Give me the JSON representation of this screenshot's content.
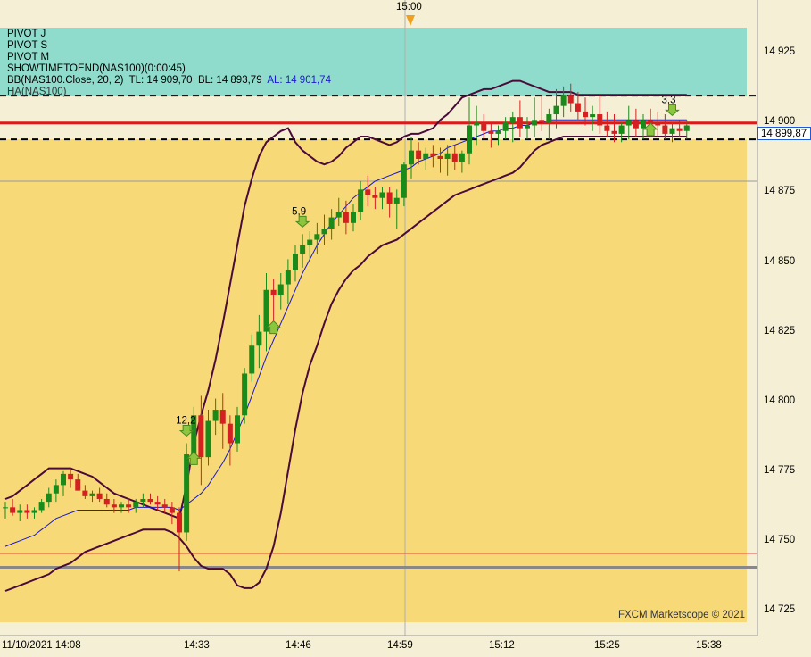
{
  "legend": {
    "line1": "PIVOT J",
    "line2": "PIVOT S",
    "line3": "PIVOT M",
    "line4": "SHOWTIMETOEND(NAS100)(0:00:45)",
    "bb_prefix": "BB(NAS100.Close, 20, 2)",
    "bb_tl": "TL: 14 909,70",
    "bb_bl": "BL: 14 893,79",
    "bb_al": "AL: 14 901,74",
    "line6": "HA(NAS100)"
  },
  "copyright": "FXCM Marketscope © 2021",
  "top_tick": "15:00",
  "current_price_label": "14 899,87",
  "colors": {
    "bull": "#1a8a1a",
    "bear": "#d42020",
    "background_zone": "#f7d978",
    "pivot_zone": "#8fdccc",
    "bollinger": "#4a0a3a",
    "middle_band": "#1a1ad0",
    "pivot_red": "#e01818"
  },
  "chart_data": {
    "type": "candlestick",
    "symbol": "NAS100",
    "y_ticks": [
      "14 925",
      "14 900",
      "14 875",
      "14 850",
      "14 825",
      "14 800",
      "14 775",
      "14 750",
      "14 725"
    ],
    "y_tick_values": [
      14925,
      14900,
      14875,
      14850,
      14825,
      14800,
      14775,
      14750,
      14725
    ],
    "ylim": [
      14716,
      14944
    ],
    "x_ticks": [
      "11/10/2021 14:08",
      "14:33",
      "14:46",
      "14:59",
      "15:12",
      "15:25",
      "15:38"
    ],
    "horizontal_levels": [
      {
        "value": 14909.7,
        "style": "dashed",
        "color": "#000000"
      },
      {
        "value": 14899.87,
        "style": "solid",
        "color": "#e01818"
      },
      {
        "value": 14894,
        "style": "dashed",
        "color": "#000000"
      },
      {
        "value": 14879,
        "style": "solid",
        "color": "#999999"
      },
      {
        "value": 14745.5,
        "style": "solid",
        "color": "#e01818"
      },
      {
        "value": 14740.5,
        "style": "solid",
        "color": "#888888"
      }
    ],
    "signals": [
      {
        "label": "12,2",
        "index": 25,
        "direction": "down"
      },
      {
        "label": "5,9",
        "index": 41,
        "direction": "down"
      },
      {
        "label": "3,3",
        "index": 92,
        "direction": "down"
      }
    ],
    "candles": [
      [
        14762,
        14764,
        14758,
        14762
      ],
      [
        14762,
        14765,
        14759,
        14760
      ],
      [
        14760,
        14763,
        14757,
        14761
      ],
      [
        14761,
        14763,
        14758,
        14760
      ],
      [
        14760,
        14762,
        14758,
        14761
      ],
      [
        14761,
        14765,
        14760,
        14764
      ],
      [
        14764,
        14769,
        14762,
        14767
      ],
      [
        14767,
        14772,
        14764,
        14770
      ],
      [
        14770,
        14775,
        14766,
        14774
      ],
      [
        14774,
        14776,
        14769,
        14772
      ],
      [
        14772,
        14774,
        14768,
        14768
      ],
      [
        14768,
        14770,
        14765,
        14766
      ],
      [
        14766,
        14768,
        14764,
        14767
      ],
      [
        14767,
        14769,
        14764,
        14765
      ],
      [
        14765,
        14767,
        14762,
        14763
      ],
      [
        14763,
        14765,
        14760,
        14762
      ],
      [
        14762,
        14764,
        14760,
        14763
      ],
      [
        14763,
        14765,
        14760,
        14762
      ],
      [
        14762,
        14765,
        14760,
        14764
      ],
      [
        14764,
        14767,
        14762,
        14765
      ],
      [
        14765,
        14767,
        14763,
        14764
      ],
      [
        14764,
        14766,
        14761,
        14763
      ],
      [
        14763,
        14765,
        14760,
        14762
      ],
      [
        14762,
        14764,
        14756,
        14760
      ],
      [
        14760,
        14762,
        14739,
        14753
      ],
      [
        14753,
        14785,
        14750,
        14781
      ],
      [
        14781,
        14798,
        14778,
        14795
      ],
      [
        14795,
        14802,
        14770,
        14780
      ],
      [
        14780,
        14797,
        14777,
        14793
      ],
      [
        14793,
        14801,
        14788,
        14797
      ],
      [
        14797,
        14803,
        14783,
        14792
      ],
      [
        14792,
        14795,
        14777,
        14785
      ],
      [
        14785,
        14798,
        14782,
        14795
      ],
      [
        14795,
        14812,
        14792,
        14810
      ],
      [
        14810,
        14824,
        14807,
        14820
      ],
      [
        14820,
        14831,
        14812,
        14825
      ],
      [
        14825,
        14846,
        14818,
        14840
      ],
      [
        14840,
        14844,
        14825,
        14838
      ],
      [
        14838,
        14846,
        14833,
        14842
      ],
      [
        14842,
        14851,
        14835,
        14847
      ],
      [
        14847,
        14856,
        14843,
        14853
      ],
      [
        14853,
        14860,
        14848,
        14856
      ],
      [
        14856,
        14861,
        14851,
        14858
      ],
      [
        14858,
        14864,
        14853,
        14860
      ],
      [
        14860,
        14867,
        14856,
        14862
      ],
      [
        14862,
        14869,
        14858,
        14866
      ],
      [
        14866,
        14873,
        14863,
        14868
      ],
      [
        14868,
        14872,
        14860,
        14864
      ],
      [
        14864,
        14871,
        14861,
        14868
      ],
      [
        14868,
        14879,
        14865,
        14876
      ],
      [
        14876,
        14881,
        14870,
        14874
      ],
      [
        14874,
        14877,
        14869,
        14873
      ],
      [
        14873,
        14877,
        14869,
        14875
      ],
      [
        14875,
        14877,
        14866,
        14871
      ],
      [
        14871,
        14876,
        14862,
        14873
      ],
      [
        14873,
        14886,
        14870,
        14885
      ],
      [
        14885,
        14895,
        14880,
        14890
      ],
      [
        14890,
        14893,
        14885,
        14887
      ],
      [
        14887,
        14891,
        14883,
        14889
      ],
      [
        14889,
        14892,
        14884,
        14888
      ],
      [
        14888,
        14891,
        14882,
        14887
      ],
      [
        14887,
        14892,
        14881,
        14889
      ],
      [
        14889,
        14892,
        14883,
        14886
      ],
      [
        14886,
        14890,
        14882,
        14889
      ],
      [
        14889,
        14909,
        14885,
        14899
      ],
      [
        14899,
        14906,
        14892,
        14900
      ],
      [
        14900,
        14903,
        14894,
        14897
      ],
      [
        14897,
        14900,
        14891,
        14896
      ],
      [
        14896,
        14899,
        14892,
        14897
      ],
      [
        14897,
        14902,
        14894,
        14900
      ],
      [
        14900,
        14904,
        14893,
        14902
      ],
      [
        14902,
        14908,
        14895,
        14898
      ],
      [
        14898,
        14902,
        14894,
        14899
      ],
      [
        14899,
        14909,
        14895,
        14901
      ],
      [
        14901,
        14910,
        14897,
        14900
      ],
      [
        14900,
        14905,
        14894,
        14903
      ],
      [
        14903,
        14912,
        14898,
        14906
      ],
      [
        14906,
        14913,
        14902,
        14910
      ],
      [
        14910,
        14914,
        14904,
        14907
      ],
      [
        14907,
        14911,
        14901,
        14904
      ],
      [
        14904,
        14909,
        14899,
        14902
      ],
      [
        14902,
        14906,
        14897,
        14903
      ],
      [
        14903,
        14910,
        14896,
        14899
      ],
      [
        14899,
        14904,
        14895,
        14897
      ],
      [
        14897,
        14903,
        14893,
        14896
      ],
      [
        14896,
        14900,
        14893,
        14899
      ],
      [
        14899,
        14906,
        14894,
        14901
      ],
      [
        14901,
        14905,
        14895,
        14898
      ],
      [
        14898,
        14903,
        14894,
        14901
      ],
      [
        14901,
        14905,
        14896,
        14900
      ],
      [
        14900,
        14904,
        14895,
        14899
      ],
      [
        14899,
        14903,
        14894,
        14896
      ],
      [
        14896,
        14900,
        14893,
        14898
      ],
      [
        14898,
        14901,
        14895,
        14897
      ],
      [
        14897,
        14901,
        14894,
        14899
      ]
    ],
    "upper_band": [
      14765,
      14766,
      14768,
      14770,
      14772,
      14774,
      14776,
      14776,
      14776,
      14776,
      14775,
      14774,
      14773,
      14771,
      14769,
      14767,
      14766,
      14765,
      14764,
      14763,
      14762,
      14761,
      14760,
      14759,
      14758,
      14770,
      14785,
      14795,
      14804,
      14815,
      14828,
      14842,
      14856,
      14870,
      14880,
      14888,
      14893,
      14895,
      14897,
      14898,
      14893,
      14890,
      14888,
      14886,
      14885,
      14886,
      14888,
      14891,
      14893,
      14895,
      14895,
      14894,
      14893,
      14892,
      14893,
      14895,
      14896,
      14896,
      14897,
      14898,
      14901,
      14903,
      14906,
      14909,
      14910,
      14911,
      14912,
      14912,
      14913,
      14914,
      14915,
      14915,
      14914,
      14913,
      14912,
      14911,
      14911,
      14911,
      14911,
      14910,
      14910,
      14910,
      14910,
      14910,
      14910,
      14910,
      14910,
      14910,
      14910,
      14910,
      14910,
      14910,
      14910,
      14910,
      14910
    ],
    "middle_band": [
      14748,
      14749,
      14750,
      14751,
      14752,
      14754,
      14756,
      14758,
      14759,
      14760,
      14761,
      14761,
      14761,
      14761,
      14761,
      14761,
      14761,
      14761,
      14762,
      14762,
      14762,
      14762,
      14762,
      14762,
      14761,
      14763,
      14765,
      14767,
      14770,
      14774,
      14778,
      14783,
      14789,
      14795,
      14802,
      14809,
      14816,
      14822,
      14828,
      14834,
      14840,
      14846,
      14851,
      14856,
      14860,
      14864,
      14867,
      14870,
      14873,
      14875,
      14877,
      14879,
      14880,
      14881,
      14882,
      14883,
      14884,
      14886,
      14887,
      14888,
      14889,
      14891,
      14892,
      14893,
      14894,
      14895,
      14896,
      14897,
      14897,
      14898,
      14898,
      14899,
      14899,
      14900,
      14900,
      14901,
      14901,
      14901,
      14901,
      14901,
      14901,
      14901,
      14901,
      14901,
      14901,
      14901,
      14901,
      14901,
      14901,
      14901,
      14901,
      14901,
      14901,
      14901,
      14901
    ],
    "lower_band": [
      14732,
      14733,
      14734,
      14735,
      14736,
      14737,
      14738,
      14740,
      14741,
      14742,
      14744,
      14746,
      14747,
      14748,
      14749,
      14750,
      14751,
      14752,
      14753,
      14754,
      14754,
      14754,
      14754,
      14753,
      14751,
      14748,
      14744,
      14741,
      14740,
      14740,
      14740,
      14738,
      14734,
      14733,
      14733,
      14735,
      14740,
      14748,
      14760,
      14775,
      14790,
      14803,
      14813,
      14820,
      14828,
      14835,
      14840,
      14844,
      14847,
      14849,
      14852,
      14854,
      14856,
      14857,
      14858,
      14860,
      14862,
      14864,
      14866,
      14868,
      14870,
      14872,
      14874,
      14875,
      14876,
      14877,
      14878,
      14879,
      14880,
      14881,
      14882,
      14884,
      14887,
      14890,
      14892,
      14893,
      14894,
      14895,
      14895,
      14895,
      14895,
      14895,
      14895,
      14895,
      14895,
      14895,
      14895,
      14895,
      14895,
      14895,
      14895,
      14895,
      14895,
      14895,
      14895
    ]
  }
}
